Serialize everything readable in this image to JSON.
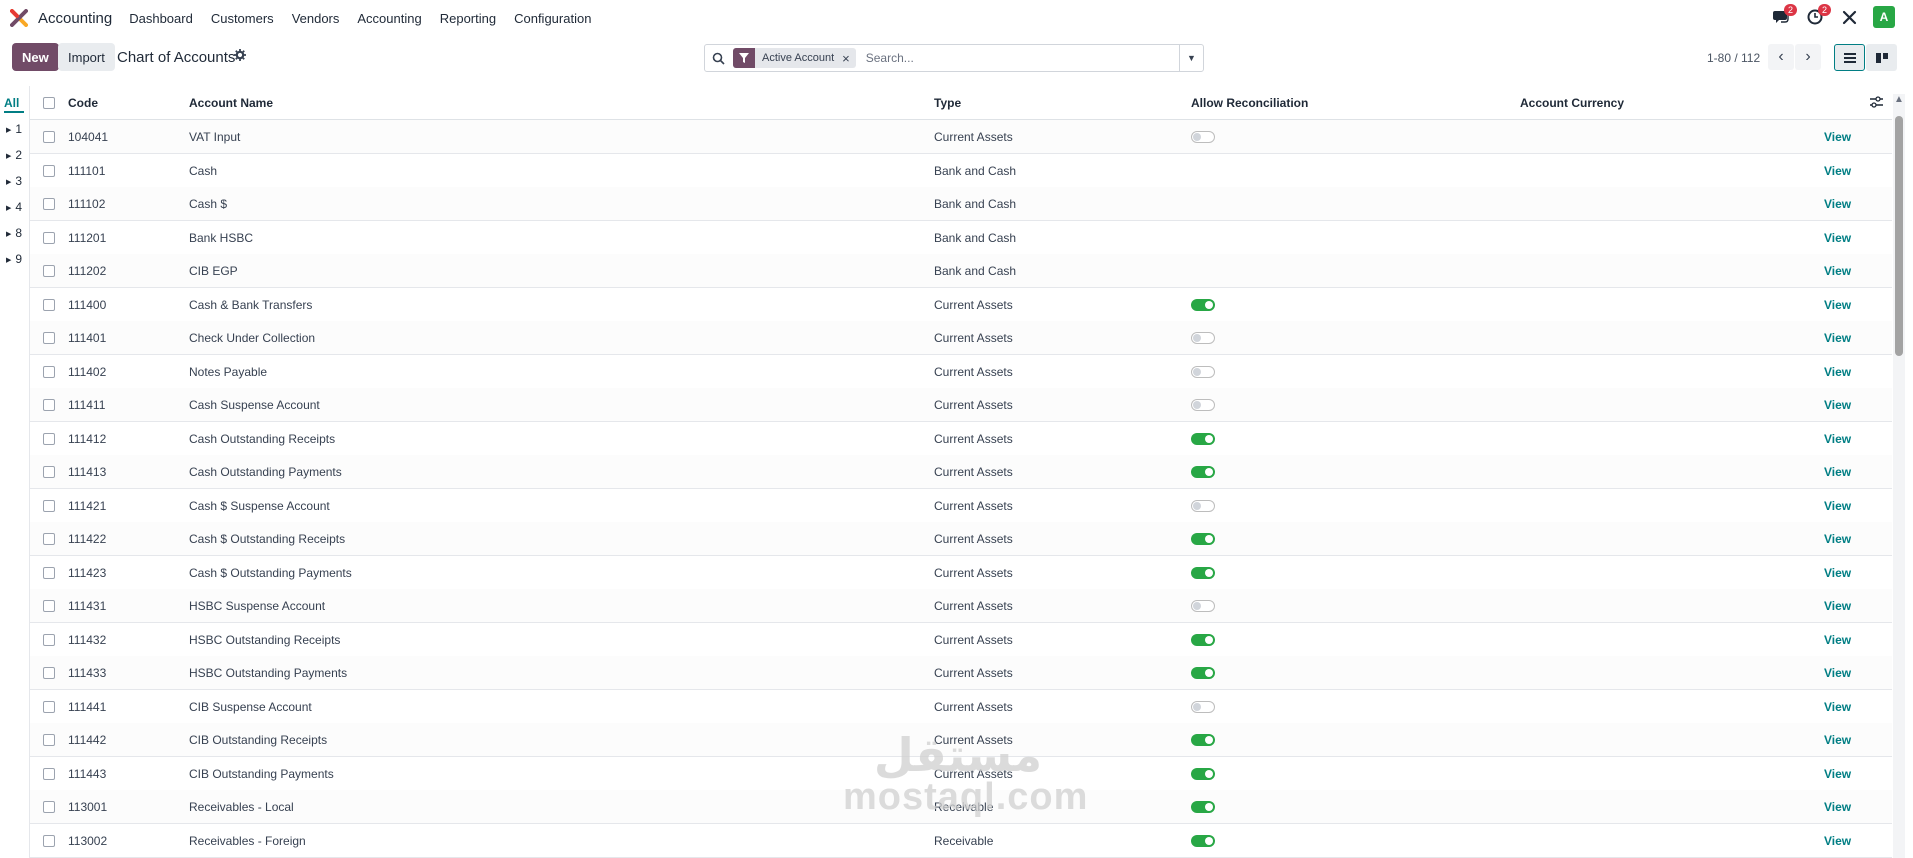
{
  "navbar": {
    "app_name": "Accounting",
    "menu": [
      "Dashboard",
      "Customers",
      "Vendors",
      "Accounting",
      "Reporting",
      "Configuration"
    ],
    "messages_badge": "2",
    "activities_badge": "2",
    "avatar_letter": "A",
    "brand_color": "#714b67"
  },
  "control": {
    "new_label": "New",
    "import_label": "Import",
    "title": "Chart of Accounts",
    "facet_label": "Active Account",
    "search_placeholder": "Search...",
    "pager": "1-80 / 112"
  },
  "sidebar": {
    "all_label": "All",
    "groups": [
      "1",
      "2",
      "3",
      "4",
      "8",
      "9"
    ]
  },
  "table": {
    "columns": {
      "code": "Code",
      "name": "Account Name",
      "type": "Type",
      "reconcile": "Allow Reconciliation",
      "currency": "Account Currency"
    },
    "view_label": "View",
    "rows": [
      {
        "code": "104041",
        "name": "VAT Input",
        "type": "Current Assets",
        "reconcile": "off"
      },
      {
        "code": "111101",
        "name": "Cash",
        "type": "Bank and Cash",
        "reconcile": "none"
      },
      {
        "code": "111102",
        "name": "Cash $",
        "type": "Bank and Cash",
        "reconcile": "none"
      },
      {
        "code": "111201",
        "name": "Bank HSBC",
        "type": "Bank and Cash",
        "reconcile": "none"
      },
      {
        "code": "111202",
        "name": "CIB EGP",
        "type": "Bank and Cash",
        "reconcile": "none"
      },
      {
        "code": "111400",
        "name": "Cash & Bank Transfers",
        "type": "Current Assets",
        "reconcile": "on"
      },
      {
        "code": "111401",
        "name": "Check Under Collection",
        "type": "Current Assets",
        "reconcile": "off"
      },
      {
        "code": "111402",
        "name": "Notes Payable",
        "type": "Current Assets",
        "reconcile": "off"
      },
      {
        "code": "111411",
        "name": "Cash Suspense Account",
        "type": "Current Assets",
        "reconcile": "off"
      },
      {
        "code": "111412",
        "name": "Cash Outstanding Receipts",
        "type": "Current Assets",
        "reconcile": "on"
      },
      {
        "code": "111413",
        "name": "Cash Outstanding Payments",
        "type": "Current Assets",
        "reconcile": "on"
      },
      {
        "code": "111421",
        "name": "Cash $ Suspense Account",
        "type": "Current Assets",
        "reconcile": "off"
      },
      {
        "code": "111422",
        "name": "Cash $ Outstanding Receipts",
        "type": "Current Assets",
        "reconcile": "on"
      },
      {
        "code": "111423",
        "name": "Cash $ Outstanding Payments",
        "type": "Current Assets",
        "reconcile": "on"
      },
      {
        "code": "111431",
        "name": "HSBC Suspense Account",
        "type": "Current Assets",
        "reconcile": "off"
      },
      {
        "code": "111432",
        "name": "HSBC Outstanding Receipts",
        "type": "Current Assets",
        "reconcile": "on"
      },
      {
        "code": "111433",
        "name": "HSBC Outstanding Payments",
        "type": "Current Assets",
        "reconcile": "on"
      },
      {
        "code": "111441",
        "name": "CIB Suspense Account",
        "type": "Current Assets",
        "reconcile": "off"
      },
      {
        "code": "111442",
        "name": "CIB Outstanding Receipts",
        "type": "Current Assets",
        "reconcile": "on"
      },
      {
        "code": "111443",
        "name": "CIB Outstanding Payments",
        "type": "Current Assets",
        "reconcile": "on"
      },
      {
        "code": "113001",
        "name": "Receivables - Local",
        "type": "Receivable",
        "reconcile": "on"
      },
      {
        "code": "113002",
        "name": "Receivables - Foreign",
        "type": "Receivable",
        "reconcile": "on"
      }
    ]
  },
  "watermark": {
    "line1": "مستقل",
    "line2": "mostaql.com"
  }
}
